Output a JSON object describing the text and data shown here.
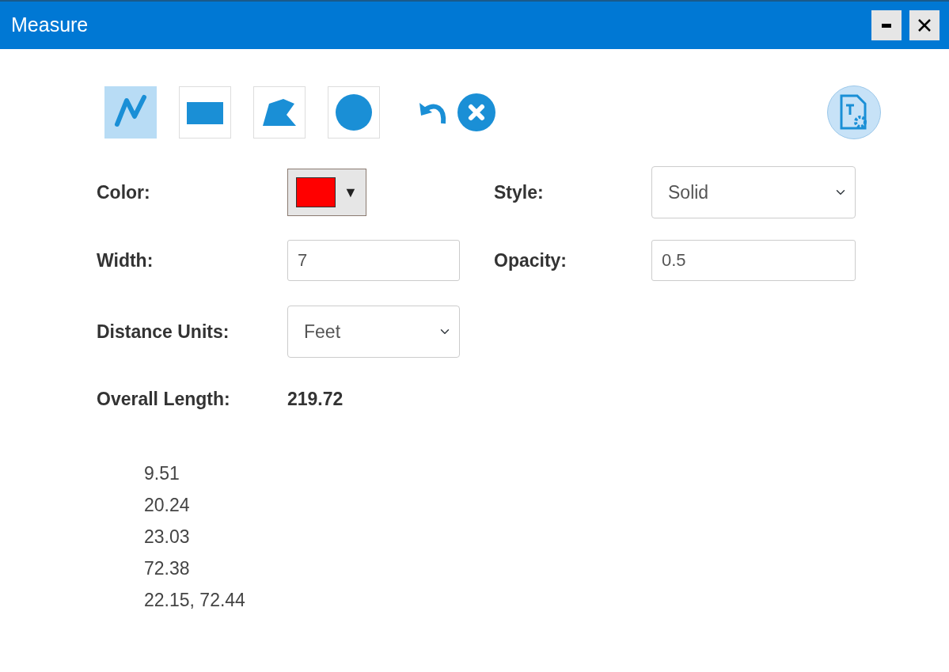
{
  "window": {
    "title": "Measure"
  },
  "tools": [
    {
      "kind": "polyline",
      "selected": true
    },
    {
      "kind": "rectangle",
      "selected": false
    },
    {
      "kind": "polygon",
      "selected": false
    },
    {
      "kind": "circle",
      "selected": false
    }
  ],
  "form": {
    "color": {
      "label": "Color:",
      "color": "#ff0000",
      "caret": "▼"
    },
    "style": {
      "label": "Style:",
      "value": "Solid"
    },
    "width": {
      "label": "Width:",
      "value": "7"
    },
    "opacity": {
      "label": "Opacity:",
      "value": "0.5"
    },
    "distance_units": {
      "label": "Distance Units:",
      "value": "Feet"
    }
  },
  "overall_length": {
    "label": "Overall Length:",
    "value": "219.72"
  },
  "segments": [
    "9.51",
    "20.24",
    "23.03",
    "72.38",
    "22.15, 72.44"
  ]
}
